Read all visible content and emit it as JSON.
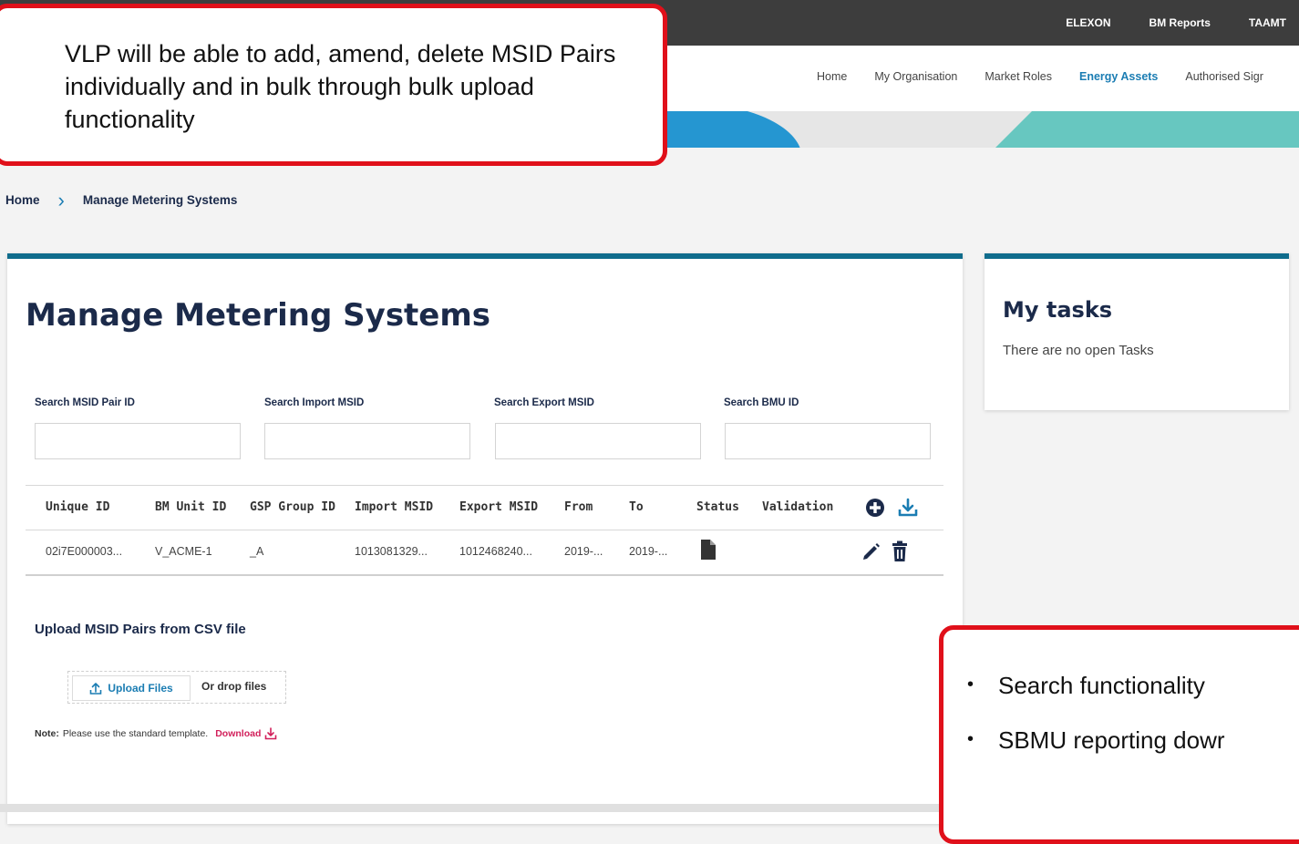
{
  "top_links": [
    "ELEXON",
    "BM Reports",
    "TAAMT"
  ],
  "nav": {
    "items": [
      "Home",
      "My Organisation",
      "Market Roles",
      "Energy Assets",
      "Authorised Sigr"
    ],
    "active": "Energy Assets"
  },
  "breadcrumb": {
    "home": "Home",
    "current": "Manage Metering Systems"
  },
  "page": {
    "title": "Manage Metering Systems"
  },
  "search": {
    "labels": [
      "Search MSID Pair ID",
      "Search Import MSID",
      "Search Export MSID",
      "Search BMU ID"
    ]
  },
  "table": {
    "headers": [
      "Unique ID",
      "BM Unit ID",
      "GSP Group ID",
      "Import MSID",
      "Export MSID",
      "From",
      "To",
      "Status",
      "Validation"
    ],
    "rows": [
      [
        "02i7E000003...",
        "V_ACME-1",
        "_A",
        "1013081329...",
        "1012468240...",
        "2019-...",
        "2019-..."
      ]
    ]
  },
  "upload": {
    "title": "Upload MSID Pairs from CSV file",
    "button": "Upload Files",
    "drop": "Or drop files",
    "note_prefix": "Note:",
    "note_text": "Please use the standard template.",
    "download": "Download"
  },
  "tasks": {
    "title": "My tasks",
    "empty": "There are no open Tasks"
  },
  "callout1": {
    "text": "VLP will be able to add, amend, delete MSID Pairs individually and in bulk through bulk upload functionality"
  },
  "callout2": {
    "items": [
      "Search functionality",
      "SBMU reporting dowr"
    ]
  },
  "colors": {
    "accent": "#1b7db3",
    "navy": "#1b2a4a",
    "teal_bar": "#0f6c8c",
    "callout_border": "#e0101a",
    "download_link": "#d11f5a"
  }
}
